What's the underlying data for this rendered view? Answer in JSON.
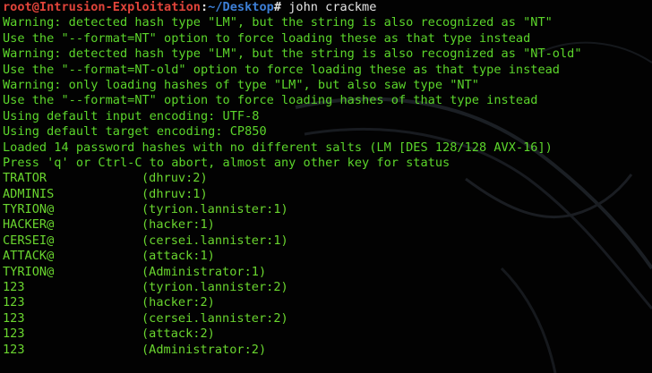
{
  "colors": {
    "background": "#020202",
    "prompt_user": "#e0443a",
    "prompt_path": "#3d7fd6",
    "output_text": "#5cd62b"
  },
  "prompt": {
    "user_host": "root@Intrusion-Exploitation",
    "separator": ":",
    "path": "~/Desktop",
    "symbol": "#",
    "command": " john crackme"
  },
  "output_lines": [
    "Warning: detected hash type \"LM\", but the string is also recognized as \"NT\"",
    "Use the \"--format=NT\" option to force loading these as that type instead",
    "Warning: detected hash type \"LM\", but the string is also recognized as \"NT-old\"",
    "Use the \"--format=NT-old\" option to force loading these as that type instead",
    "Warning: only loading hashes of type \"LM\", but also saw type \"NT\"",
    "Use the \"--format=NT\" option to force loading hashes of that type instead",
    "Using default input encoding: UTF-8",
    "Using default target encoding: CP850",
    "Loaded 14 password hashes with no different salts (LM [DES 128/128 AVX-16])",
    "Press 'q' or Ctrl-C to abort, almost any other key for status"
  ],
  "cracked": [
    {
      "password": "TRATOR",
      "account": "(dhruv:2)"
    },
    {
      "password": "ADMINIS",
      "account": "(dhruv:1)"
    },
    {
      "password": "TYRION@",
      "account": "(tyrion.lannister:1)"
    },
    {
      "password": "HACKER@",
      "account": "(hacker:1)"
    },
    {
      "password": "CERSEI@",
      "account": "(cersei.lannister:1)"
    },
    {
      "password": "ATTACK@",
      "account": "(attack:1)"
    },
    {
      "password": "TYRION@",
      "account": "(Administrator:1)"
    },
    {
      "password": "123",
      "account": "(tyrion.lannister:2)"
    },
    {
      "password": "123",
      "account": "(hacker:2)"
    },
    {
      "password": "123",
      "account": "(cersei.lannister:2)"
    },
    {
      "password": "123",
      "account": "(attack:2)"
    },
    {
      "password": "123",
      "account": "(Administrator:2)"
    }
  ]
}
